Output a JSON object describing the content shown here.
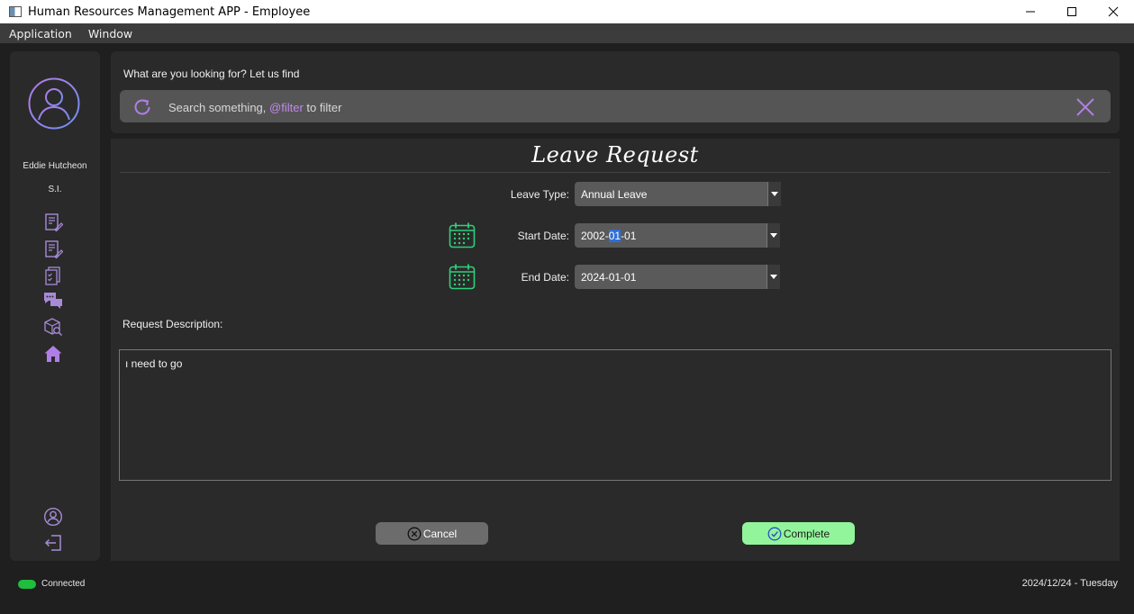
{
  "window": {
    "title": "Human Resources Management APP - Employee",
    "controls": [
      "minimize-icon",
      "maximize-icon",
      "close-icon"
    ]
  },
  "menubar": {
    "items": [
      {
        "label": "Application"
      },
      {
        "label": "Window"
      }
    ]
  },
  "sidebar": {
    "user_name": "Eddie Hutcheon",
    "user_role": "S.I.",
    "nav_icons": [
      "document-edit-icon",
      "document-edit-icon",
      "document-checklist-icon",
      "chat-icon",
      "box-search-icon",
      "home-icon"
    ],
    "bottom_icons": [
      "user-profile-icon",
      "logout-icon"
    ]
  },
  "search": {
    "prompt": "What are you looking for? Let us find",
    "placeholder_before": "Search something, ",
    "placeholder_highlight": "@filter",
    "placeholder_after": " to filter"
  },
  "form": {
    "title": "Leave Request",
    "leave_type_label": "Leave Type:",
    "leave_type_value": "Annual Leave",
    "start_date_label": "Start Date:",
    "start_date_year": "2002-",
    "start_date_month": "01",
    "start_date_day": "-01",
    "end_date_label": "End Date:",
    "end_date_value": "2024-01-01",
    "description_label": "Request Description:",
    "description_value": "ı need to go",
    "cancel_label": "Cancel",
    "complete_label": "Complete"
  },
  "status": {
    "connection": "Connected",
    "date": "2024/12/24 - Tuesday"
  },
  "colors": {
    "accent_purple": "#b07fe6",
    "calendar_green": "#2ed07a",
    "complete_green": "#92f59b",
    "connected_green": "#1fbe3e"
  }
}
